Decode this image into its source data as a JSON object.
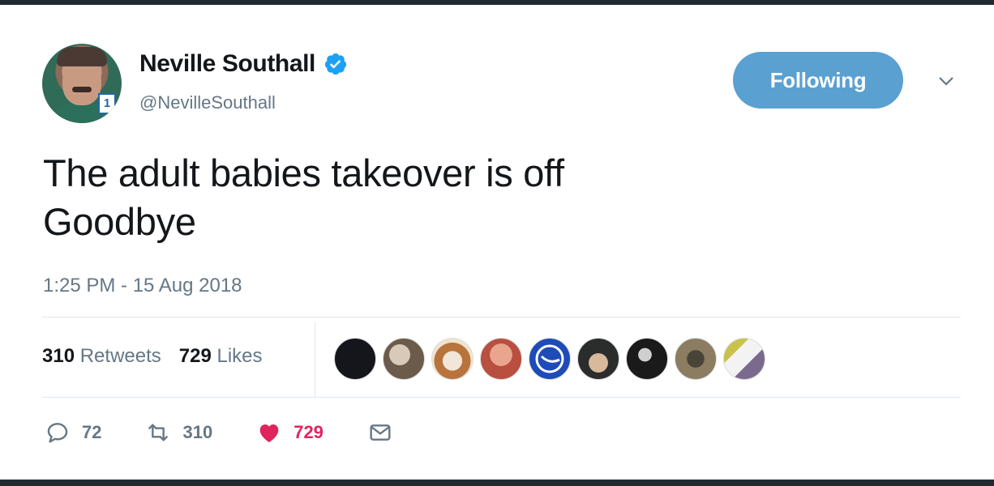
{
  "tweet": {
    "author_name": "Neville Southall",
    "handle": "@NevilleSouthall",
    "follow_label": "Following",
    "text_line1": "The adult babies takeover is off",
    "text_line2": "Goodbye",
    "timestamp": "1:25 PM - 15 Aug 2018",
    "retweets_count": "310",
    "retweets_label": "Retweets",
    "likes_count": "729",
    "likes_label": "Likes",
    "actions": {
      "reply_count": "72",
      "retweet_count": "310",
      "like_count": "729"
    }
  },
  "colors": {
    "brand_blue": "#5aa0d1",
    "like_red": "#e0245e",
    "text_dark": "#14171a",
    "text_gray": "#657786"
  },
  "icons": [
    "verified-icon",
    "chevron-down-icon",
    "reply-icon",
    "retweet-icon",
    "heart-icon",
    "message-icon"
  ]
}
